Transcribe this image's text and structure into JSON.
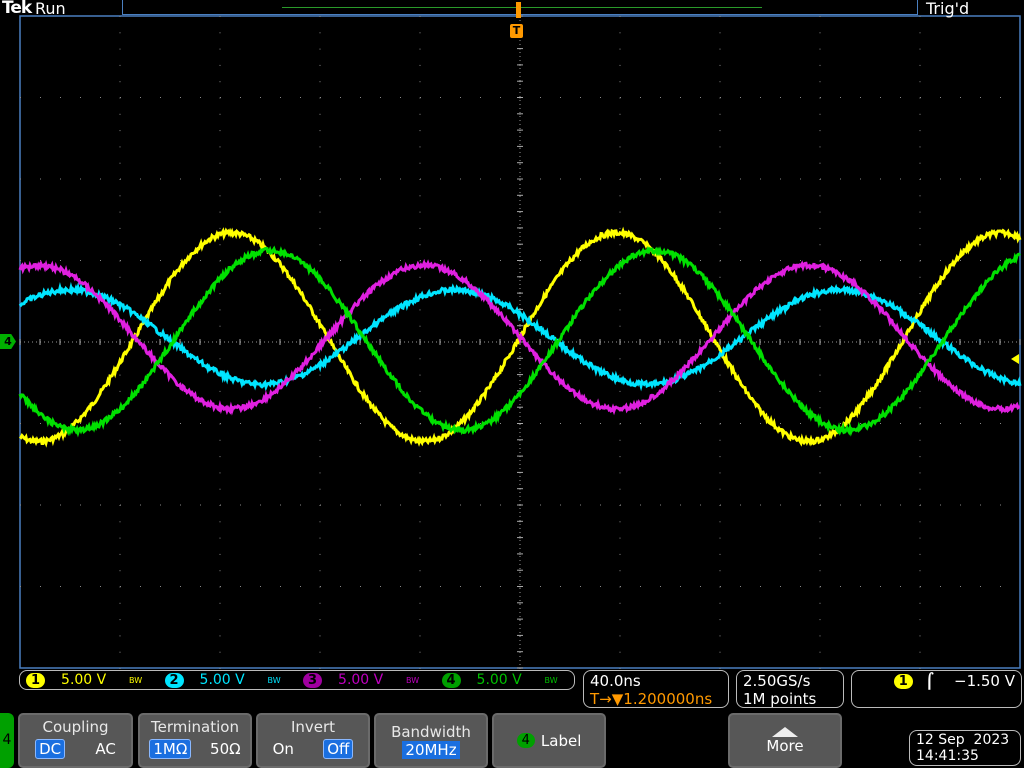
{
  "header": {
    "brand": "Tek",
    "state": "Run",
    "trigger_status": "Trig'd"
  },
  "markers": {
    "trigger_pos": "T",
    "ch4_ground": "4"
  },
  "channels": [
    {
      "num": "1",
      "scale": "5.00 V",
      "bw": "BW",
      "color": "#ffff00"
    },
    {
      "num": "2",
      "scale": "5.00 V",
      "bw": "BW",
      "color": "#00e5ff"
    },
    {
      "num": "3",
      "scale": "5.00 V",
      "bw": "BW",
      "color": "#c000c0"
    },
    {
      "num": "4",
      "scale": "5.00 V",
      "bw": "BW",
      "color": "#00c000"
    }
  ],
  "timebase": {
    "scale": "40.0ns",
    "delay_icon": "T→▼",
    "delay": "1.200000ns"
  },
  "acquisition": {
    "rate": "2.50GS/s",
    "length": "1M points"
  },
  "trigger": {
    "source": "1",
    "slope_icon": "rising-edge",
    "level": "−1.50 V"
  },
  "menu": {
    "channel": "4",
    "coupling": {
      "label": "Coupling",
      "options": [
        "DC",
        "AC"
      ],
      "selected": "DC"
    },
    "termination": {
      "label": "Termination",
      "options": [
        "1MΩ",
        "50Ω"
      ],
      "selected": "1MΩ"
    },
    "invert": {
      "label": "Invert",
      "options": [
        "On",
        "Off"
      ],
      "selected": "Off"
    },
    "bandwidth": {
      "label": "Bandwidth",
      "value": "20MHz"
    },
    "label": {
      "channel": "4",
      "label": "Label"
    },
    "more": {
      "label": "More"
    }
  },
  "datetime": {
    "date": "12 Sep  2023",
    "time": "14:41:35"
  },
  "chart_data": {
    "type": "line",
    "x_unit": "ns",
    "x_per_div": 40,
    "x_range": [
      -200,
      200
    ],
    "y_unit": "V",
    "y_per_div": 5,
    "y_range": [
      -20,
      20
    ],
    "grid": true,
    "series": [
      {
        "name": "CH1",
        "color": "#ffff00",
        "amplitude_V": 6.4,
        "period_ns": 154,
        "phase_deg": 0,
        "offset_V": 0.3
      },
      {
        "name": "CH2",
        "color": "#00e5ff",
        "amplitude_V": 2.9,
        "period_ns": 154,
        "phase_deg": 151,
        "offset_V": 0.3
      },
      {
        "name": "CH3",
        "color": "#e020e0",
        "amplitude_V": 4.4,
        "period_ns": 154,
        "phase_deg": 180,
        "offset_V": 0.3
      },
      {
        "name": "CH4",
        "color": "#00e000",
        "amplitude_V": 5.5,
        "period_ns": 154,
        "phase_deg": -36,
        "offset_V": 0.1
      }
    ]
  }
}
